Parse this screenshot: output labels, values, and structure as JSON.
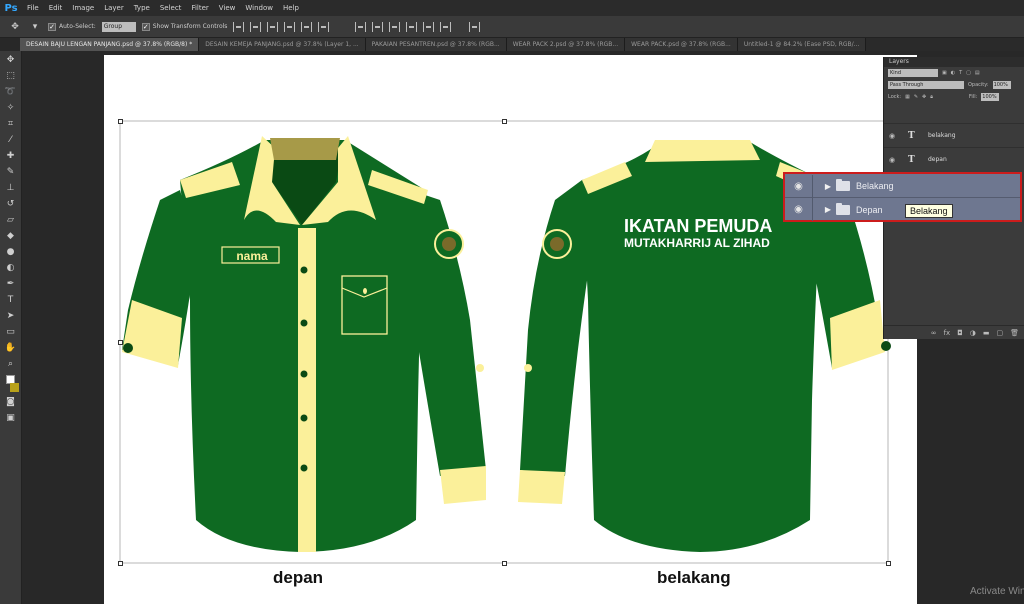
{
  "app": {
    "logo": "Ps"
  },
  "menu": [
    "File",
    "Edit",
    "Image",
    "Layer",
    "Type",
    "Select",
    "Filter",
    "View",
    "Window",
    "Help"
  ],
  "options_bar": {
    "auto_select_label": "Auto-Select:",
    "auto_select_value": "Group",
    "show_transform_label": "Show Transform Controls"
  },
  "tabs": [
    {
      "label": "DESAIN BAJU LENGAN PANJANG.psd @ 37.8% (RGB/8) *",
      "active": true
    },
    {
      "label": "DESAIN KEMEJA PANJANG.psd @ 37.8% (Layer 1, ...",
      "active": false
    },
    {
      "label": "PAKAIAN PESANTREN.psd @ 37.8% (RGB...",
      "active": false
    },
    {
      "label": "WEAR PACK 2.psd @ 37.8% (RGB...",
      "active": false
    },
    {
      "label": "WEAR PACK.psd @ 37.8% (RGB...",
      "active": false
    },
    {
      "label": "Untitled-1 @ 84.2% (Ease PSD, RGB/...",
      "active": false
    }
  ],
  "canvas": {
    "front_label": "depan",
    "back_label": "belakang",
    "name_tag": "nama",
    "back_text_line1": "IKATAN PEMUDA",
    "back_text_line2": "MUTAKHARRIJ AL ZIHAD",
    "colors": {
      "shirt": "#0e6a22",
      "accent": "#fbf09a",
      "dark_collar": "#0a4a14"
    }
  },
  "layers_panel": {
    "title": "Layers",
    "kind_label": "Kind",
    "blend_mode": "Pass Through",
    "opacity_label": "Opacity:",
    "opacity_value": "100%",
    "lock_label": "Lock:",
    "fill_label": "Fill:",
    "fill_value": "100%",
    "layers": [
      {
        "name": "belakang",
        "type": "text"
      },
      {
        "name": "depan",
        "type": "text"
      }
    ]
  },
  "highlight": {
    "rows": [
      {
        "name": "Belakang",
        "type": "group"
      },
      {
        "name": "Depan",
        "type": "group"
      }
    ],
    "tooltip": "Belakang",
    "border_color": "#cc1c1c"
  },
  "watermark": "Activate Windows"
}
